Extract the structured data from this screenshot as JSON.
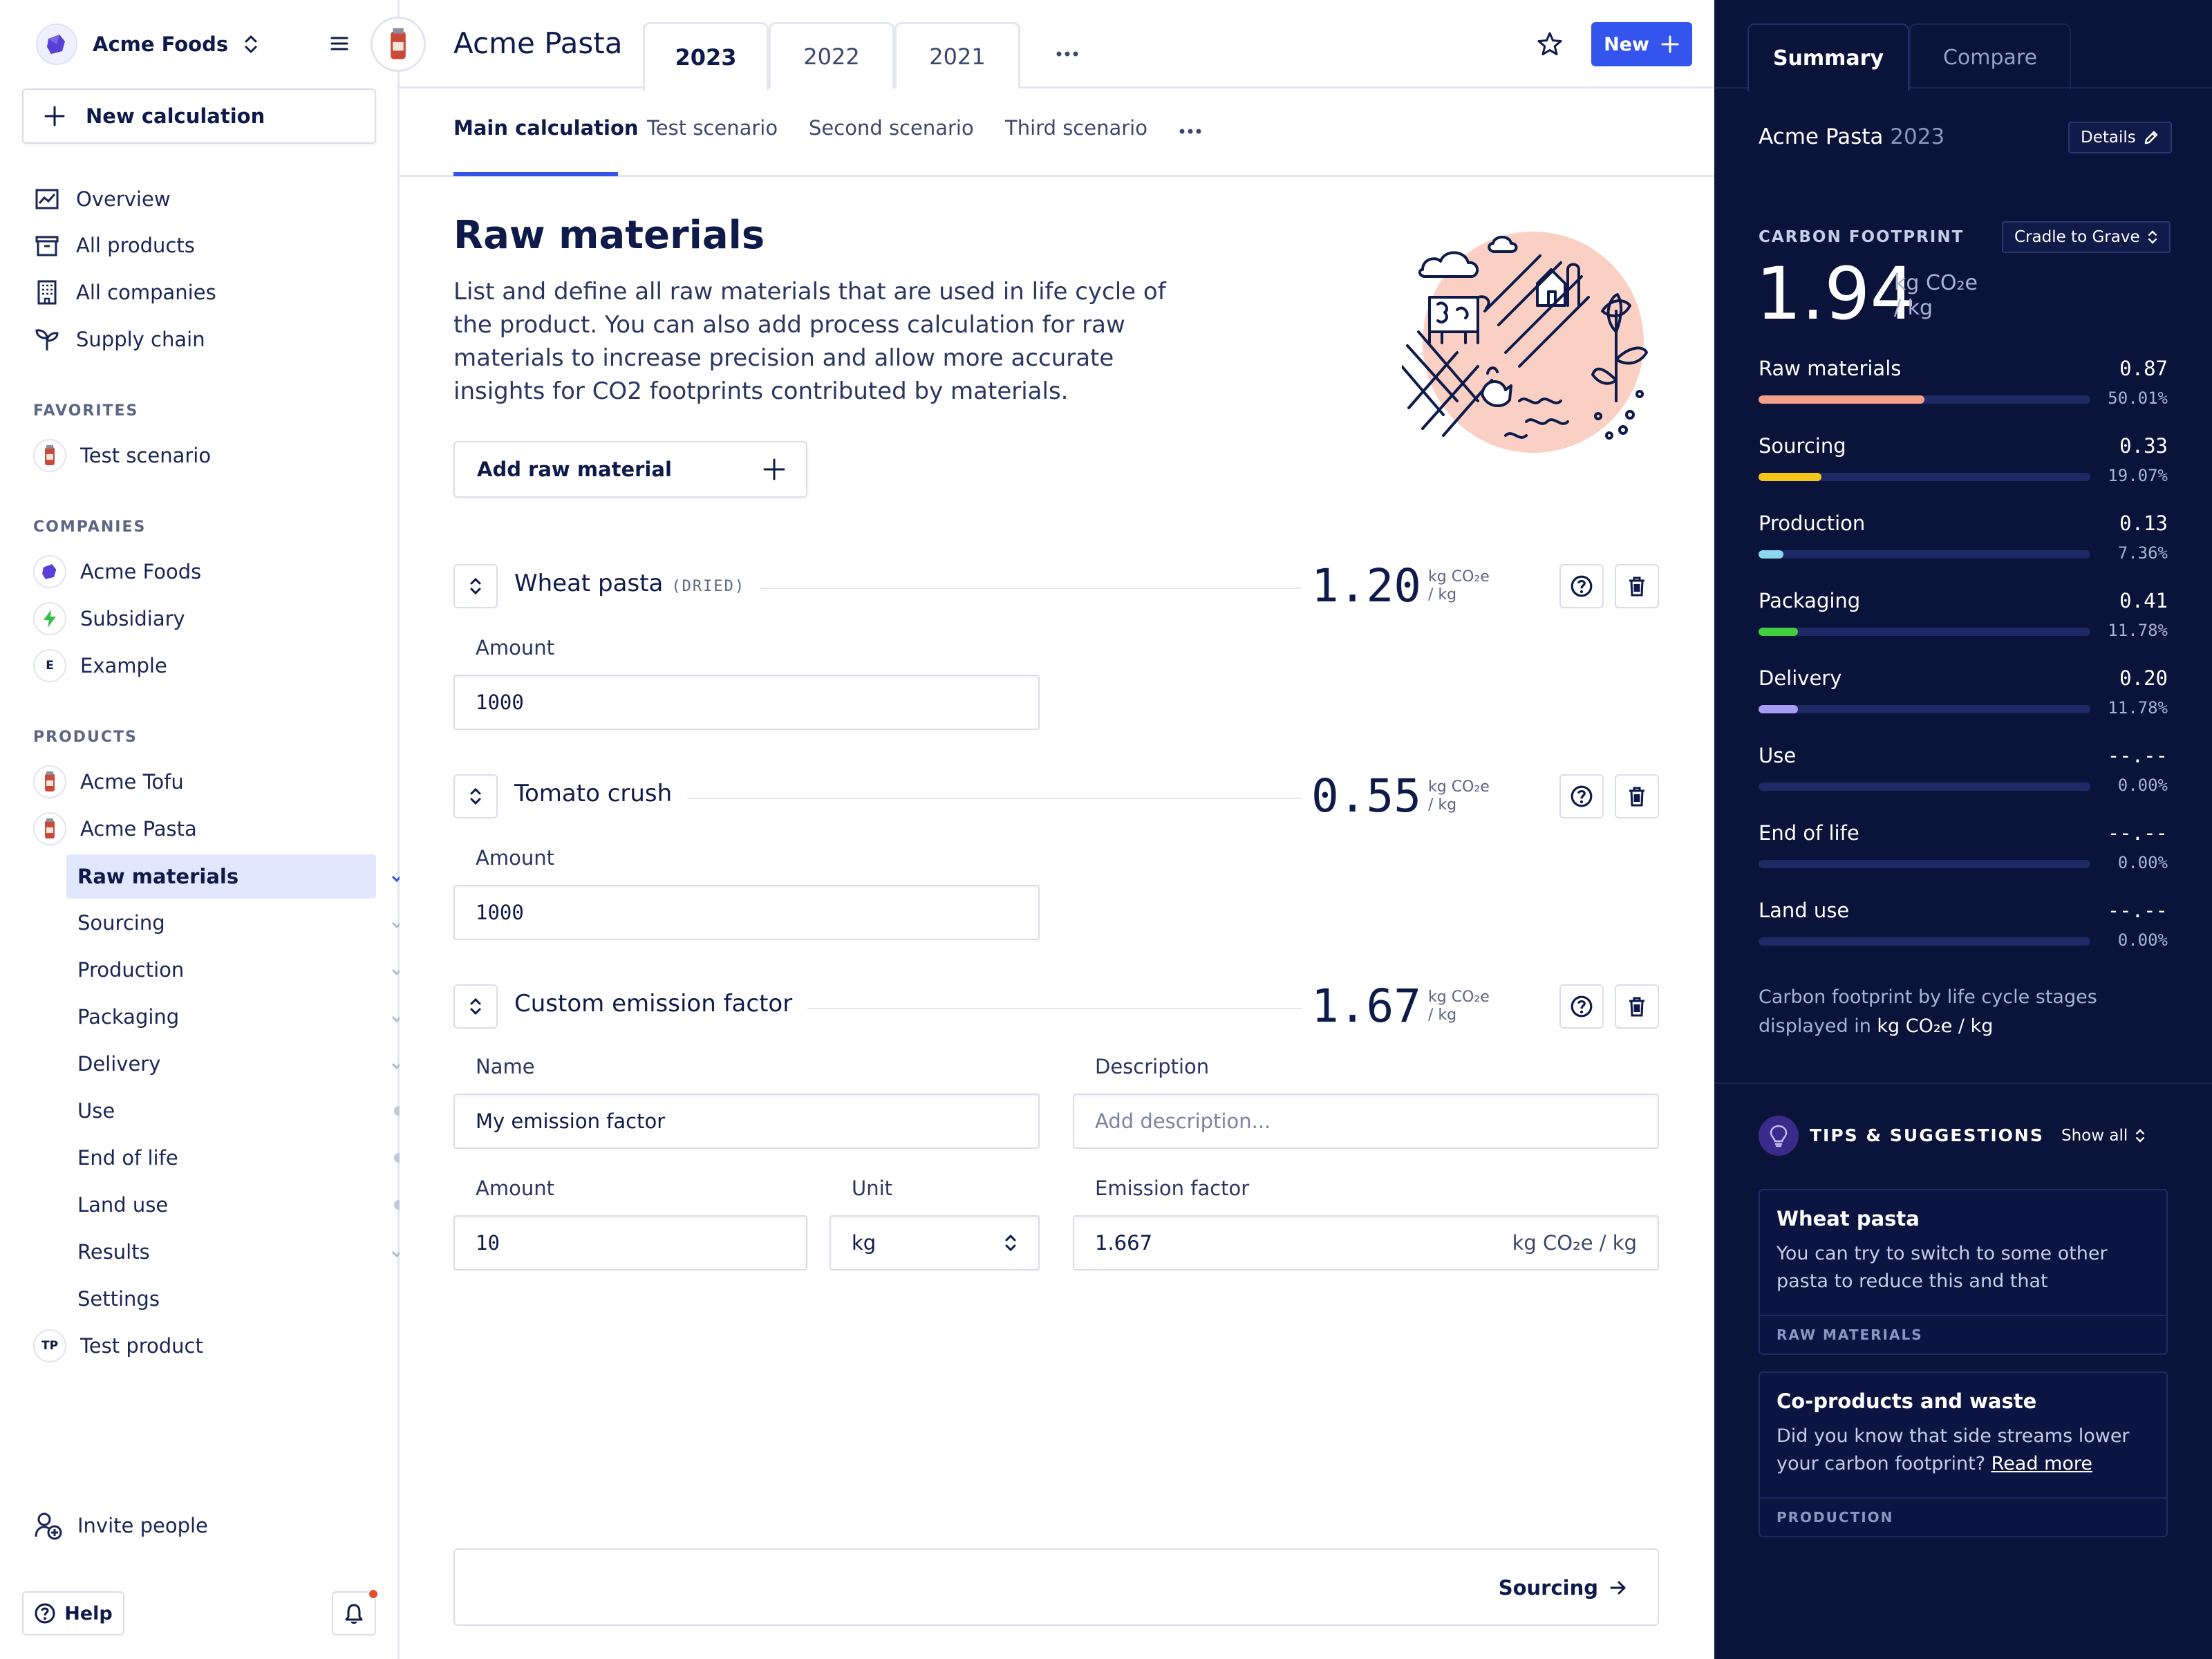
{
  "sidebar": {
    "org_name": "Acme Foods",
    "new_calculation": "New calculation",
    "nav": [
      "Overview",
      "All products",
      "All companies",
      "Supply chain"
    ],
    "favorites_label": "FAVORITES",
    "favorites": [
      "Test scenario"
    ],
    "companies_label": "COMPANIES",
    "companies": [
      {
        "name": "Acme Foods",
        "icon": "acme-logo"
      },
      {
        "name": "Subsidiary",
        "icon": "bolt-logo"
      },
      {
        "name": "Example",
        "initials": "E"
      }
    ],
    "products_label": "PRODUCTS",
    "products": [
      {
        "name": "Acme Tofu"
      },
      {
        "name": "Acme Pasta"
      }
    ],
    "sub_items": [
      {
        "label": "Raw materials",
        "status": "check",
        "active": true
      },
      {
        "label": "Sourcing",
        "status": "check"
      },
      {
        "label": "Production",
        "status": "check"
      },
      {
        "label": "Packaging",
        "status": "check"
      },
      {
        "label": "Delivery",
        "status": "check"
      },
      {
        "label": "Use",
        "status": "dot"
      },
      {
        "label": "End of life",
        "status": "dot"
      },
      {
        "label": "Land use",
        "status": "dot"
      },
      {
        "label": "Results",
        "status": "check"
      },
      {
        "label": "Settings",
        "status": "none"
      }
    ],
    "test_product": {
      "name": "Test product",
      "initials": "TP"
    },
    "invite": "Invite people",
    "help": "Help"
  },
  "header": {
    "product_title": "Acme Pasta",
    "years": [
      "2023",
      "2022",
      "2021"
    ],
    "new_button": "New"
  },
  "scenarios": [
    "Main calculation",
    "Test scenario",
    "Second scenario",
    "Third scenario"
  ],
  "content": {
    "title": "Raw materials",
    "description": "List and define all raw materials that are used in life cycle of the product. You can also add process calculation for raw materials to increase precision and allow more accurate insights for CO2 footprints contributed by materials.",
    "add_button": "Add raw material",
    "unit_line1": "kg CO₂e",
    "unit_line2": "/ kg",
    "materials": [
      {
        "name": "Wheat pasta",
        "tag": "(DRIED)",
        "value": "1.20",
        "amount_label": "Amount",
        "amount": "1000"
      },
      {
        "name": "Tomato crush",
        "tag": "",
        "value": "0.55",
        "amount_label": "Amount",
        "amount": "1000"
      },
      {
        "name": "Custom emission factor",
        "tag": "",
        "value": "1.67"
      }
    ],
    "custom": {
      "name_label": "Name",
      "name_value": "My emission factor",
      "description_label": "Description",
      "description_placeholder": "Add description...",
      "amount_label": "Amount",
      "amount_value": "10",
      "unit_label": "Unit",
      "unit_value": "kg",
      "ef_label": "Emission factor",
      "ef_value": "1.667",
      "ef_unit": "kg CO₂e / kg"
    },
    "next_link": "Sourcing"
  },
  "panel": {
    "tabs": [
      "Summary",
      "Compare"
    ],
    "product": "Acme Pasta",
    "year": "2023",
    "details": "Details",
    "cf_label": "CARBON FOOTPRINT",
    "scope": "Cradle to Grave",
    "cf_value": "1.94",
    "cf_unit1": "kg CO₂e",
    "cf_unit2": "/ kg",
    "stages": [
      {
        "name": "Raw materials",
        "value": "0.87",
        "pct": "50.01%",
        "fraction": 0.5,
        "color": "#f29f8c"
      },
      {
        "name": "Sourcing",
        "value": "0.33",
        "pct": "19.07%",
        "fraction": 0.19,
        "color": "#f5c518"
      },
      {
        "name": "Production",
        "value": "0.13",
        "pct": "7.36%",
        "fraction": 0.074,
        "color": "#8ad7ef"
      },
      {
        "name": "Packaging",
        "value": "0.41",
        "pct": "11.78%",
        "fraction": 0.118,
        "color": "#3fcf3f"
      },
      {
        "name": "Delivery",
        "value": "0.20",
        "pct": "11.78%",
        "fraction": 0.118,
        "color": "#a99cf5"
      },
      {
        "name": "Use",
        "value": "--.--",
        "pct": "0.00%",
        "fraction": 0,
        "color": "#a99cf5"
      },
      {
        "name": "End of life",
        "value": "--.--",
        "pct": "0.00%",
        "fraction": 0,
        "color": "#a99cf5"
      },
      {
        "name": "Land use",
        "value": "--.--",
        "pct": "0.00%",
        "fraction": 0,
        "color": "#a99cf5"
      }
    ],
    "note_text": "Carbon footprint by life cycle stages displayed in",
    "note_unit": "kg CO₂e / kg",
    "tips_title": "TIPS & SUGGESTIONS",
    "show_all": "Show all",
    "tips": [
      {
        "title": "Wheat pasta",
        "body": "You can try to switch to some other pasta to reduce this and that",
        "link": "",
        "category": "RAW MATERIALS"
      },
      {
        "title": "Co-products and waste",
        "body": "Did you know that side streams lower your carbon footprint?",
        "link": "Read more",
        "category": "PRODUCTION"
      }
    ]
  }
}
